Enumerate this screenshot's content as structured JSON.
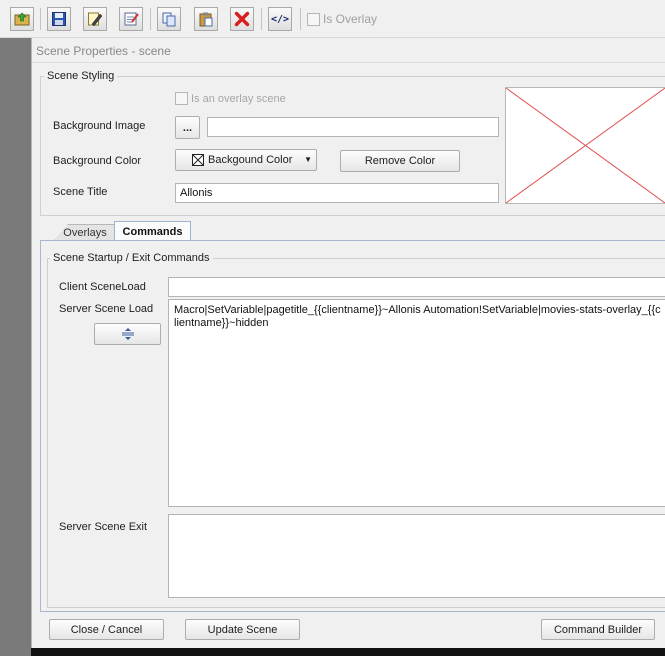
{
  "toolbar": {
    "buttons": [
      {
        "name": "export-scene-button",
        "icon": "export-icon"
      },
      {
        "name": "save-button",
        "icon": "floppy-disk-icon"
      },
      {
        "name": "edit-scene-button",
        "icon": "pencil-icon"
      },
      {
        "name": "scene-properties-button",
        "icon": "notepad-icon"
      },
      {
        "name": "copy-button",
        "icon": "copy-icon"
      },
      {
        "name": "paste-button",
        "icon": "clipboard-icon"
      },
      {
        "name": "delete-button",
        "icon": "red-x-icon"
      },
      {
        "name": "source-code-button",
        "icon": "code-tag-icon"
      }
    ],
    "is_overlay_label": "Is Overlay",
    "code_glyph": "</>"
  },
  "dialog": {
    "title": "Scene Properties - scene",
    "styling": {
      "legend": "Scene Styling",
      "overlay_checkbox_label": "Is an overlay scene",
      "background_image_label": "Background Image",
      "browse_label": "...",
      "background_image_value": "",
      "background_color_label": "Background Color",
      "color_dropdown_label": "Backgound Color",
      "remove_color_label": "Remove Color",
      "scene_title_label": "Scene Title",
      "scene_title_value": "Allonis"
    },
    "tabs": [
      {
        "label": "Overlays",
        "active": false
      },
      {
        "label": "Commands",
        "active": true
      }
    ],
    "commands": {
      "legend": "Scene Startup / Exit Commands",
      "client_load_label": "Client SceneLoad",
      "client_load_value": "",
      "server_load_label": "Server Scene Load",
      "server_load_value": "Macro|SetVariable|pagetitle_{{clientname}}~Allonis Automation!SetVariable|movies-stats-overlay_{{clientname}}~hidden",
      "server_exit_label": "Server Scene Exit",
      "server_exit_value": ""
    },
    "footer": {
      "close_label": "Close / Cancel",
      "update_label": "Update Scene",
      "builder_label": "Command Builder"
    }
  },
  "colors": {
    "delete_red": "#d81e1e",
    "tab_border": "#9fb3cc",
    "preview_cross": "#e05050"
  }
}
